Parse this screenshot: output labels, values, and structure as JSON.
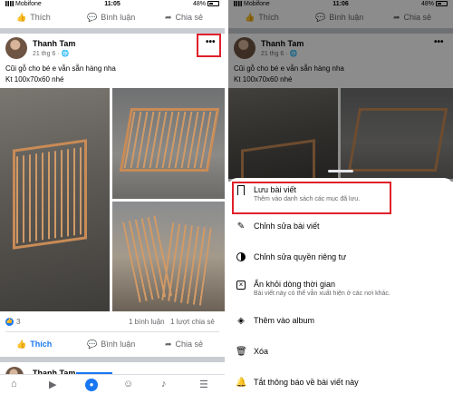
{
  "status_left": {
    "carrier": "Mobifone",
    "time": "11:05",
    "battery": "48%"
  },
  "status_right": {
    "carrier": "Mobifone",
    "time": "11:06",
    "battery": "48%"
  },
  "top_actions": {
    "like": "Thích",
    "comment": "Bình luận",
    "share": "Chia sẻ"
  },
  "post": {
    "author": "Thanh Tam",
    "date": "21 thg 6 · ",
    "caption_line1": "Cũi gỗ cho bé e vẫn sẵn hàng nha",
    "caption_line2": "Kt 100x70x60 nhé",
    "more": "•••",
    "reaction_count": "3",
    "comments": "1 bình luận",
    "shares": "1 lượt chia sẻ"
  },
  "bottom_actions": {
    "like": "Thích",
    "comment": "Bình luận",
    "share": "Chia sẻ"
  },
  "next_post": {
    "author": "Thanh Tam"
  },
  "menu": [
    {
      "label": "Lưu bài viết",
      "sub": "Thêm vào danh sách các mục đã lưu.",
      "icon": "bookmark-icon"
    },
    {
      "label": "Chỉnh sửa bài viết",
      "sub": "",
      "icon": "pencil-icon"
    },
    {
      "label": "Chỉnh sửa quyền riêng tư",
      "sub": "",
      "icon": "privacy-icon"
    },
    {
      "label": "Ẩn khỏi dòng thời gian",
      "sub": "Bài viết này có thể vẫn xuất hiện ở các nơi khác.",
      "icon": "hide-icon"
    },
    {
      "label": "Thêm vào album",
      "sub": "",
      "icon": "album-icon"
    },
    {
      "label": "Xóa",
      "sub": "",
      "icon": "trash-icon"
    },
    {
      "label": "Tắt thông báo về bài viết này",
      "sub": "",
      "icon": "bell-icon"
    }
  ],
  "colors": {
    "accent": "#1877f2",
    "highlight": "#e0202a",
    "divider": "#c9ccd1"
  }
}
